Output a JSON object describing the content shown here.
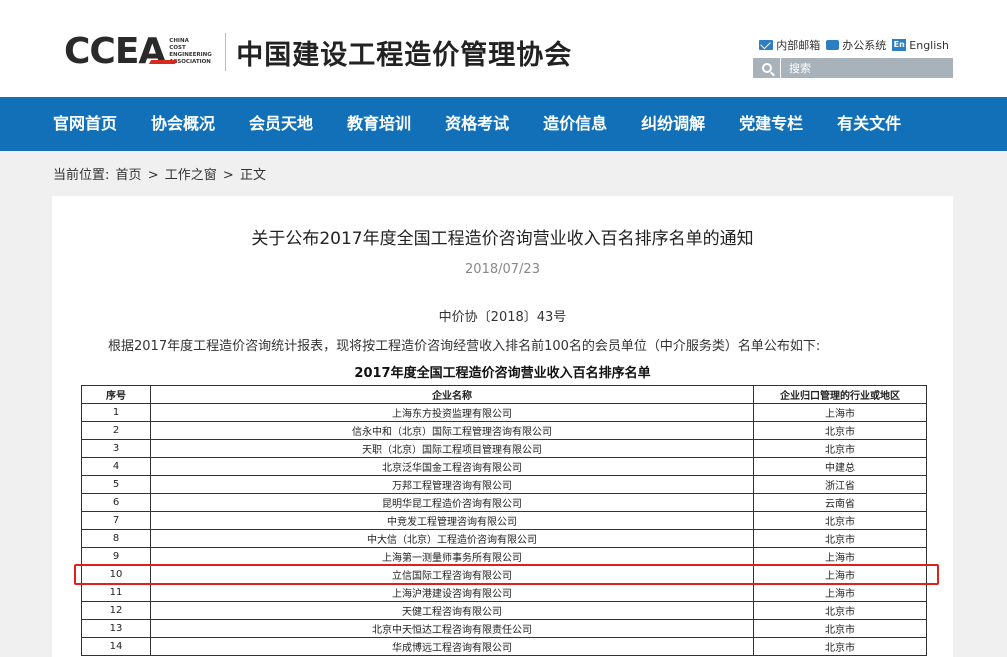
{
  "header": {
    "logo_text": "CCEA",
    "logo_sub": [
      "CHINA",
      "COST",
      "ENGINEERING",
      "ASSOCIATION"
    ],
    "site_title": "中国建设工程造价管理协会",
    "links": [
      {
        "label": "内部邮箱",
        "icon": "mail-icon"
      },
      {
        "label": "办公系统",
        "icon": "briefcase-icon"
      },
      {
        "label": "English",
        "icon": "en-icon"
      }
    ],
    "en_badge": "En",
    "search_placeholder": "搜索"
  },
  "nav": [
    "官网首页",
    "协会概况",
    "会员天地",
    "教育培训",
    "资格考试",
    "造价信息",
    "纠纷调解",
    "党建专栏",
    "有关文件"
  ],
  "breadcrumb": {
    "prefix": "当前位置:",
    "items": [
      "首页",
      "工作之窗",
      "正文"
    ],
    "sep": ">"
  },
  "article": {
    "title": "关于公布2017年度全国工程造价咨询营业收入百名排序名单的通知",
    "date": "2018/07/23",
    "ref": "中价协〔2018〕43号",
    "intro": "根据2017年度工程造价咨询统计报表，现将按工程造价咨询经营收入排名前100名的会员单位（中介服务类）名单公布如下:",
    "table_title": "2017年度全国工程造价咨询营业收入百名排序名单",
    "columns": [
      "序号",
      "企业名称",
      "企业归口管理的行业或地区"
    ],
    "rows": [
      [
        "1",
        "上海东方投资监理有限公司",
        "上海市"
      ],
      [
        "2",
        "信永中和（北京）国际工程管理咨询有限公司",
        "北京市"
      ],
      [
        "3",
        "天职（北京）国际工程项目管理有限公司",
        "北京市"
      ],
      [
        "4",
        "北京泛华国金工程咨询有限公司",
        "中建总"
      ],
      [
        "5",
        "万邦工程管理咨询有限公司",
        "浙江省"
      ],
      [
        "6",
        "昆明华昆工程造价咨询有限公司",
        "云南省"
      ],
      [
        "7",
        "中竞发工程管理咨询有限公司",
        "北京市"
      ],
      [
        "8",
        "中大信（北京）工程造价咨询有限公司",
        "北京市"
      ],
      [
        "9",
        "上海第一测量师事务所有限公司",
        "上海市"
      ],
      [
        "10",
        "立信国际工程咨询有限公司",
        "上海市"
      ],
      [
        "11",
        "上海沪港建设咨询有限公司",
        "上海市"
      ],
      [
        "12",
        "天健工程咨询有限公司",
        "北京市"
      ],
      [
        "13",
        "北京中天恒达工程咨询有限责任公司",
        "北京市"
      ],
      [
        "14",
        "华成博远工程咨询有限公司",
        "北京市"
      ]
    ],
    "highlighted_row": "10"
  },
  "colors": {
    "nav_bg": "#1170b7",
    "highlight": "#e0201c",
    "page_bg": "#f0f0f0"
  }
}
